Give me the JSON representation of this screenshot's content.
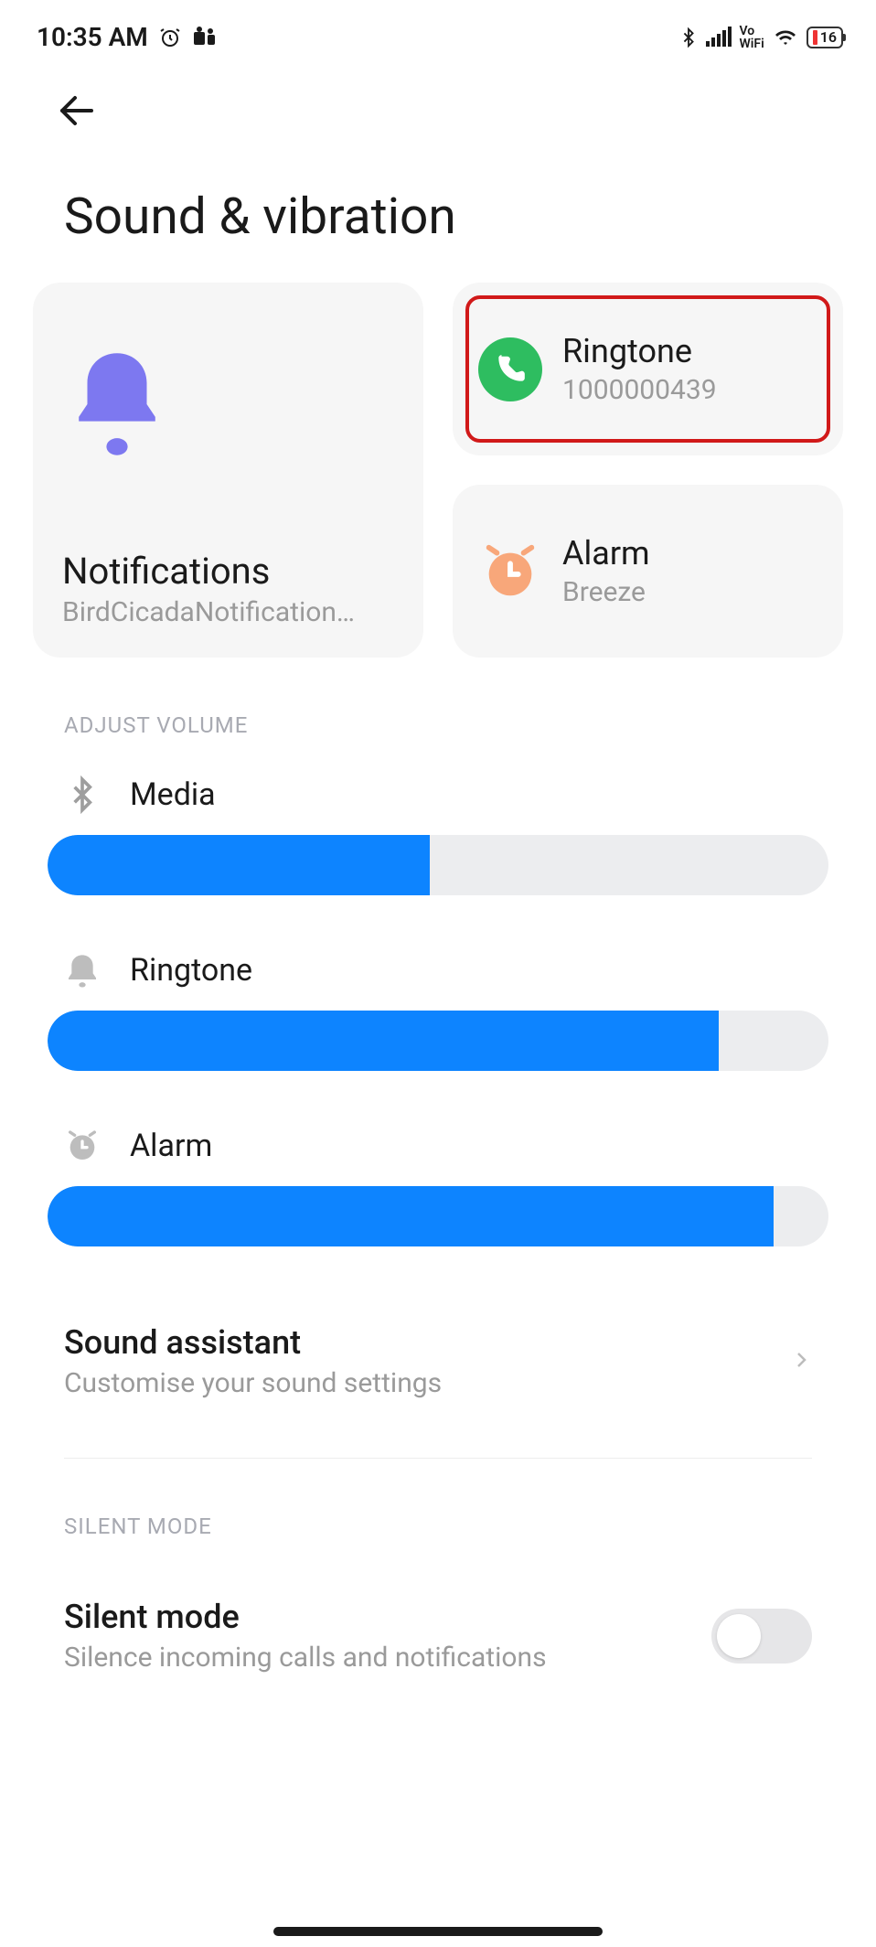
{
  "statusBar": {
    "time": "10:35 AM",
    "batteryLevel": "16"
  },
  "pageTitle": "Sound & vibration",
  "cards": {
    "notifications": {
      "label": "Notifications",
      "value": "BirdCicadaNotification…"
    },
    "ringtone": {
      "label": "Ringtone",
      "value": "1000000439"
    },
    "alarm": {
      "label": "Alarm",
      "value": "Breeze"
    }
  },
  "sections": {
    "adjustVolume": "ADJUST VOLUME",
    "silentMode": "SILENT MODE"
  },
  "volumes": {
    "media": {
      "label": "Media",
      "percent": 49
    },
    "ringtone": {
      "label": "Ringtone",
      "percent": 86
    },
    "alarm": {
      "label": "Alarm",
      "percent": 93
    }
  },
  "soundAssistant": {
    "title": "Sound assistant",
    "sub": "Customise your sound settings"
  },
  "silentMode": {
    "title": "Silent mode",
    "sub": "Silence incoming calls and notifications",
    "on": false
  },
  "colors": {
    "accentBlue": "#0d84ff",
    "bellPurple": "#7d78f0",
    "phoneGreen": "#2ebd60",
    "alarmOrange": "#f8a77a"
  }
}
